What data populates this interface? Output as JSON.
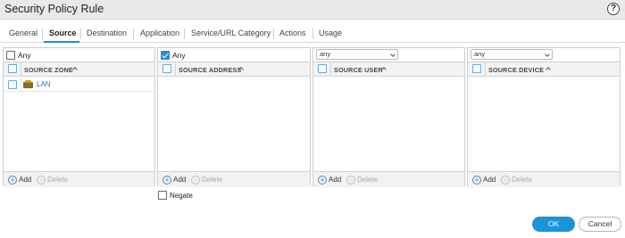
{
  "dialog": {
    "title": "Security Policy Rule",
    "help_icon": "question-circle-icon",
    "help_glyph": "?"
  },
  "tabs": [
    {
      "label": "General"
    },
    {
      "label": "Source"
    },
    {
      "label": "Destination"
    },
    {
      "label": "Application"
    },
    {
      "label": "Service/URL Category"
    },
    {
      "label": "Actions"
    },
    {
      "label": "Usage"
    }
  ],
  "active_tab": "Source",
  "accent_color": "#1a94d8",
  "panels": {
    "zone": {
      "any_label": "Any",
      "any_checked": false,
      "column": "SOURCE ZONE",
      "rows": [
        {
          "label": "LAN",
          "icon": "zone-icon"
        }
      ],
      "add_label": "Add",
      "delete_label": "Delete"
    },
    "address": {
      "any_label": "Any",
      "any_checked": true,
      "column": "SOURCE ADDRESS",
      "add_label": "Add",
      "delete_label": "Delete",
      "negate_label": "Negate",
      "negate_checked": false
    },
    "user": {
      "select_value": "any",
      "column": "SOURCE USER",
      "add_label": "Add",
      "delete_label": "Delete"
    },
    "device": {
      "select_value": "any",
      "column": "SOURCE DEVICE",
      "add_label": "Add",
      "delete_label": "Delete"
    }
  },
  "buttons": {
    "ok": "OK",
    "cancel": "Cancel"
  }
}
